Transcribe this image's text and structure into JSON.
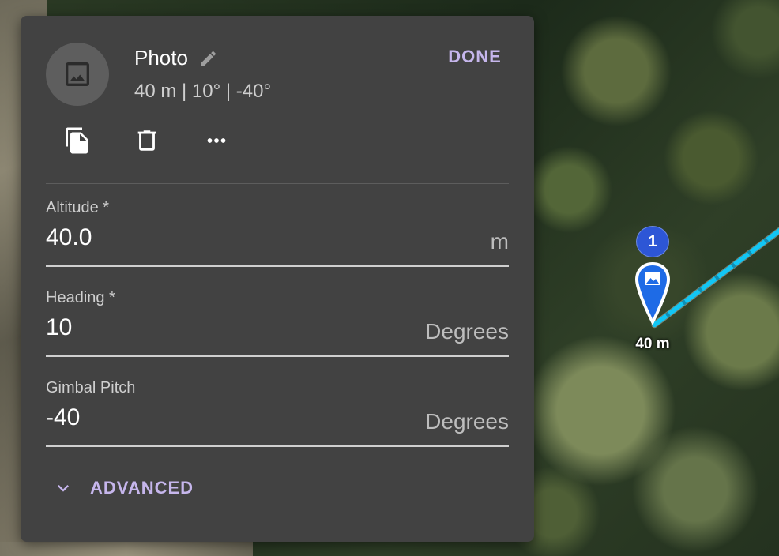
{
  "panel": {
    "title": "Photo",
    "subtitle": "40 m | 10° | -40°",
    "done_label": "DONE",
    "actions": [
      {
        "icon": "copy-icon"
      },
      {
        "icon": "trash-icon"
      },
      {
        "icon": "more-horizontal-icon"
      }
    ],
    "fields": {
      "altitude": {
        "label": "Altitude *",
        "value": "40.0",
        "suffix": "m"
      },
      "heading": {
        "label": "Heading *",
        "value": "10",
        "suffix": "Degrees"
      },
      "gimbal_pitch": {
        "label": "Gimbal Pitch",
        "value": "-40",
        "suffix": "Degrees"
      }
    },
    "advanced_label": "ADVANCED"
  },
  "map": {
    "waypoint": {
      "number": "1",
      "altitude_label": "40 m"
    }
  },
  "colors": {
    "panel_bg": "#424242",
    "accent": "#c6b6ec",
    "route": "#12c6f4",
    "waypoint_badge": "#2d56d6",
    "waypoint_pin": "#1e6be6"
  }
}
